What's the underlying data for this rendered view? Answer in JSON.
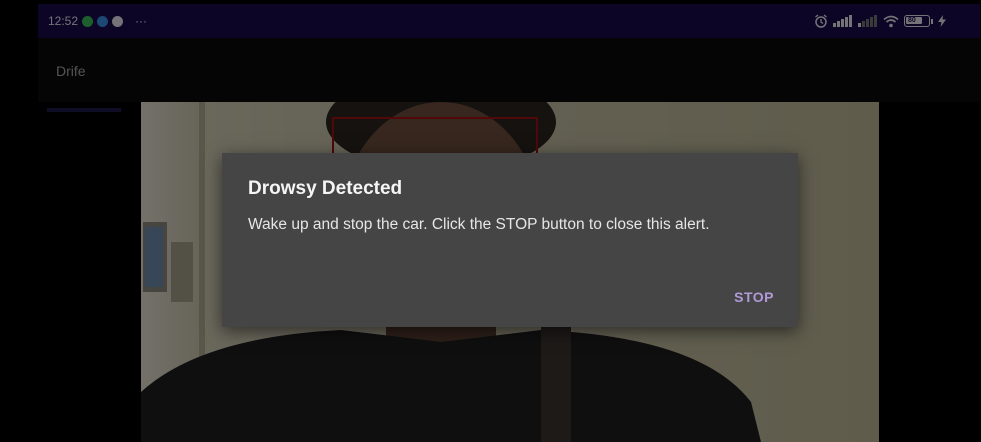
{
  "status_bar": {
    "time": "12:52",
    "more_indicator": "···",
    "battery_level": "80",
    "notification_icons": [
      "whatsapp-icon",
      "telegram-icon",
      "app-notification-icon"
    ],
    "system_icons": [
      "alarm-icon",
      "signal-icon",
      "signal-weak-icon",
      "wifi-icon",
      "battery-icon",
      "charging-icon"
    ]
  },
  "app_bar": {
    "title": "Drife"
  },
  "dialog": {
    "title": "Drowsy Detected",
    "message": "Wake up and stop the car. Click the STOP button to close this alert.",
    "button_label": "STOP"
  },
  "colors": {
    "status_bar_bg": "#1a0a4a",
    "app_bar_bg": "#0b0b0b",
    "dialog_bg": "#454545",
    "dialog_button": "#b09ad8",
    "face_box": "#a01010"
  }
}
